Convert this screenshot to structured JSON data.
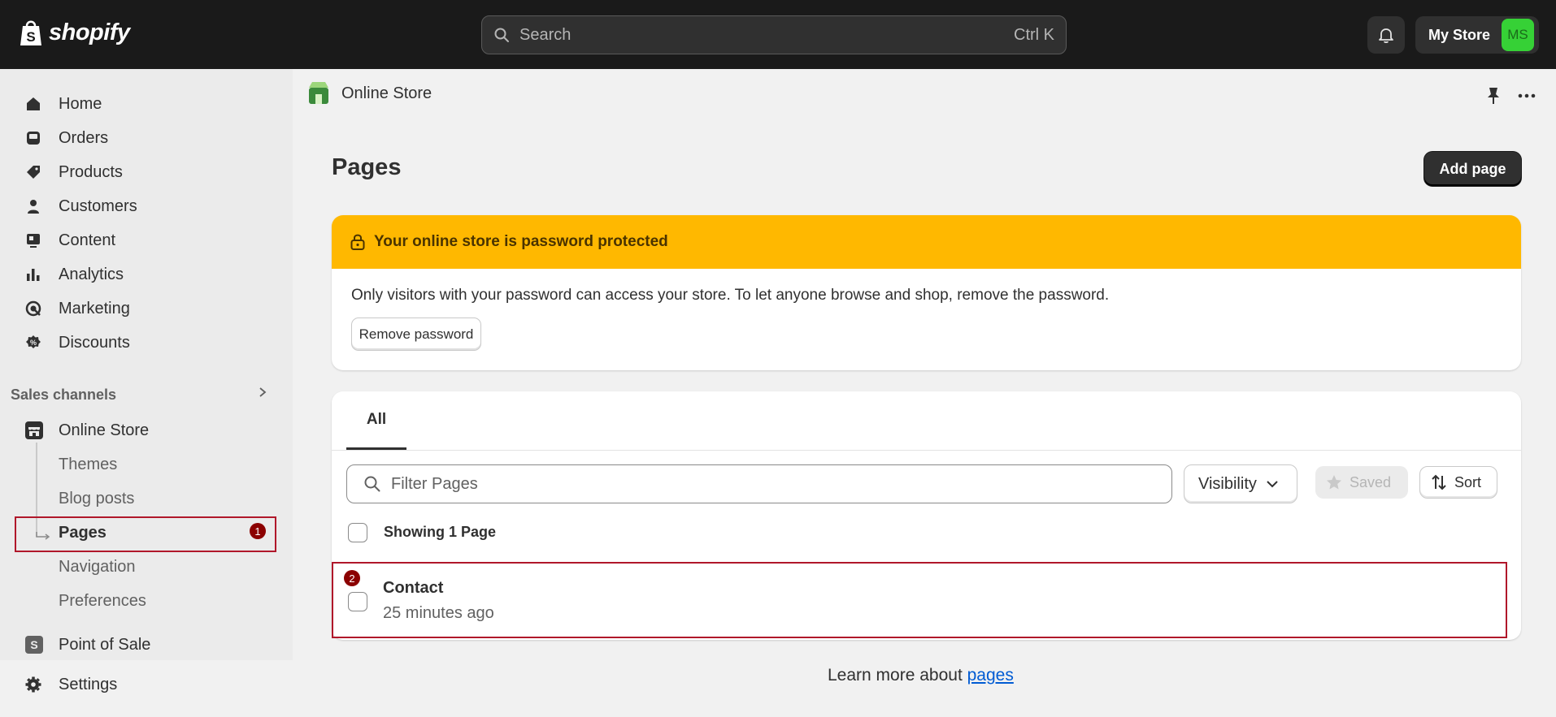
{
  "topbar": {
    "logo_text": "shopify",
    "search_placeholder": "Search",
    "search_shortcut": "Ctrl K",
    "store_name": "My Store",
    "avatar_initials": "MS"
  },
  "sidebar": {
    "items": [
      {
        "label": "Home",
        "icon": "home-icon"
      },
      {
        "label": "Orders",
        "icon": "orders-icon"
      },
      {
        "label": "Products",
        "icon": "tag-icon"
      },
      {
        "label": "Customers",
        "icon": "person-icon"
      },
      {
        "label": "Content",
        "icon": "content-icon"
      },
      {
        "label": "Analytics",
        "icon": "bar-chart-icon"
      },
      {
        "label": "Marketing",
        "icon": "target-icon"
      },
      {
        "label": "Discounts",
        "icon": "discount-icon"
      }
    ],
    "sales_channels_label": "Sales channels",
    "online_store_label": "Online Store",
    "sub_items": [
      "Themes",
      "Blog posts",
      "Pages",
      "Navigation",
      "Preferences"
    ],
    "point_of_sale_label": "Point of Sale",
    "settings_label": "Settings",
    "pages_badge": "1"
  },
  "main": {
    "breadcrumb": "Online Store",
    "page_title": "Pages",
    "add_page_label": "Add page",
    "banner": {
      "title": "Your online store is password protected",
      "text": "Only visitors with your password can access your store. To let anyone browse and shop, remove the password.",
      "button_label": "Remove password",
      "color": "#ffb800"
    },
    "tabs": [
      {
        "label": "All"
      }
    ],
    "filter_placeholder": "Filter Pages",
    "visibility_label": "Visibility",
    "saved_label": "Saved",
    "sort_label": "Sort",
    "showing_label": "Showing 1 Page",
    "rows": [
      {
        "title": "Contact",
        "subtitle": "25 minutes ago",
        "badge": "2"
      }
    ],
    "learn_prefix": "Learn more about ",
    "learn_link": "pages"
  }
}
